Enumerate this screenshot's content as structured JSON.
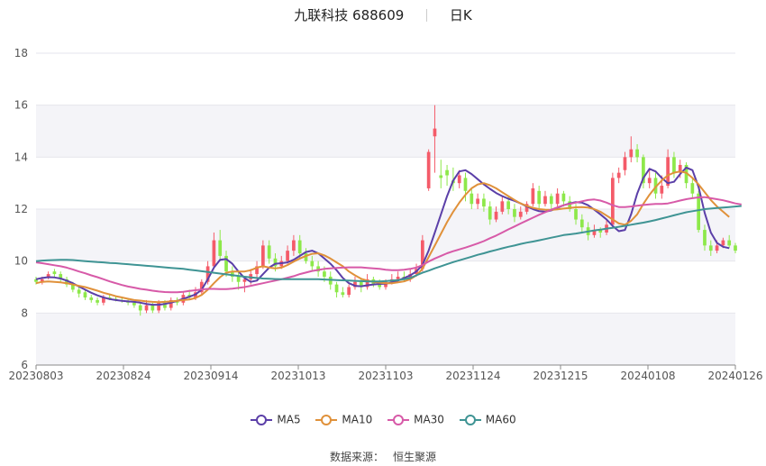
{
  "header": {
    "title": "九联科技 688609",
    "period": "日K"
  },
  "source": {
    "label": "数据来源：",
    "name": "恒生聚源"
  },
  "colors": {
    "up": "#f45b69",
    "down": "#8de84a",
    "ma5": "#5b3fa8",
    "ma10": "#e0913a",
    "ma30": "#d75aa8",
    "ma60": "#3f9494",
    "grid": "#e6e6ec",
    "plot_bg": "#f4f4f8"
  },
  "chart_data": {
    "type": "candlestick",
    "ylim": [
      6,
      18
    ],
    "yticks": [
      "6",
      "8",
      "10",
      "12",
      "14",
      "16",
      "18"
    ],
    "xticks": [
      "20230803",
      "20230824",
      "20230914",
      "20231013",
      "20231103",
      "20231124",
      "20231215",
      "20240108",
      "20240126"
    ],
    "legend_position": "bottom",
    "grid": true,
    "series": [
      {
        "name": "MA5",
        "color": "#5b3fa8",
        "values": [
          9.3,
          9.35,
          9.38,
          9.37,
          9.33,
          9.25,
          9.15,
          9.02,
          8.9,
          8.78,
          8.68,
          8.6,
          8.54,
          8.5,
          8.47,
          8.45,
          8.43,
          8.4,
          8.35,
          8.32,
          8.32,
          8.35,
          8.4,
          8.47,
          8.55,
          8.63,
          8.72,
          8.9,
          9.3,
          9.75,
          10.05,
          10.08,
          9.9,
          9.6,
          9.35,
          9.2,
          9.25,
          9.5,
          9.75,
          9.9,
          9.92,
          9.95,
          10.05,
          10.2,
          10.35,
          10.4,
          10.3,
          10.1,
          9.9,
          9.65,
          9.35,
          9.15,
          9.05,
          9.03,
          9.07,
          9.1,
          9.12,
          9.13,
          9.18,
          9.25,
          9.35,
          9.45,
          9.6,
          9.85,
          10.4,
          11.1,
          11.8,
          12.5,
          13.1,
          13.45,
          13.5,
          13.35,
          13.15,
          12.95,
          12.78,
          12.62,
          12.5,
          12.4,
          12.32,
          12.22,
          12.1,
          12.0,
          11.92,
          11.9,
          11.95,
          12.05,
          12.15,
          12.22,
          12.27,
          12.25,
          12.15,
          11.98,
          11.8,
          11.6,
          11.35,
          11.15,
          11.2,
          11.8,
          12.6,
          13.2,
          13.55,
          13.45,
          13.2,
          13.0,
          13.05,
          13.35,
          13.6,
          13.5,
          12.85,
          11.85,
          11.1,
          10.7,
          10.55,
          10.5
        ]
      },
      {
        "name": "MA10",
        "color": "#e0913a",
        "values": [
          9.15,
          9.2,
          9.22,
          9.2,
          9.18,
          9.15,
          9.1,
          9.05,
          9.0,
          8.93,
          8.86,
          8.78,
          8.72,
          8.65,
          8.6,
          8.55,
          8.5,
          8.48,
          8.45,
          8.43,
          8.42,
          8.43,
          8.45,
          8.47,
          8.5,
          8.52,
          8.58,
          8.7,
          8.9,
          9.15,
          9.38,
          9.55,
          9.6,
          9.6,
          9.6,
          9.65,
          9.75,
          9.8,
          9.75,
          9.72,
          9.75,
          9.85,
          9.98,
          10.1,
          10.2,
          10.28,
          10.3,
          10.22,
          10.1,
          9.95,
          9.8,
          9.6,
          9.45,
          9.32,
          9.25,
          9.2,
          9.17,
          9.15,
          9.15,
          9.18,
          9.22,
          9.3,
          9.45,
          9.7,
          10.15,
          10.6,
          11.05,
          11.5,
          11.9,
          12.25,
          12.55,
          12.8,
          12.95,
          13.0,
          12.92,
          12.8,
          12.65,
          12.5,
          12.35,
          12.22,
          12.12,
          12.05,
          12.0,
          11.98,
          11.97,
          11.99,
          12.02,
          12.05,
          12.07,
          12.08,
          12.06,
          12.0,
          11.9,
          11.75,
          11.6,
          11.45,
          11.4,
          11.55,
          11.8,
          12.2,
          12.55,
          12.85,
          13.1,
          13.3,
          13.4,
          13.45,
          13.4,
          13.2,
          12.95,
          12.65,
          12.35,
          12.1,
          11.9,
          11.7
        ]
      },
      {
        "name": "MA30",
        "color": "#d75aa8",
        "values": [
          9.95,
          9.92,
          9.88,
          9.84,
          9.8,
          9.75,
          9.68,
          9.6,
          9.53,
          9.45,
          9.38,
          9.3,
          9.22,
          9.15,
          9.08,
          9.02,
          8.98,
          8.93,
          8.9,
          8.86,
          8.83,
          8.81,
          8.8,
          8.8,
          8.82,
          8.85,
          8.88,
          8.91,
          8.93,
          8.93,
          8.92,
          8.92,
          8.94,
          8.97,
          9.0,
          9.05,
          9.1,
          9.15,
          9.2,
          9.25,
          9.3,
          9.36,
          9.42,
          9.5,
          9.56,
          9.62,
          9.66,
          9.7,
          9.72,
          9.74,
          9.75,
          9.76,
          9.76,
          9.76,
          9.74,
          9.72,
          9.7,
          9.67,
          9.65,
          9.65,
          9.67,
          9.7,
          9.75,
          9.85,
          9.98,
          10.1,
          10.2,
          10.3,
          10.38,
          10.45,
          10.52,
          10.6,
          10.68,
          10.77,
          10.88,
          10.98,
          11.1,
          11.22,
          11.33,
          11.45,
          11.56,
          11.67,
          11.78,
          11.88,
          11.98,
          12.07,
          12.15,
          12.2,
          12.25,
          12.3,
          12.35,
          12.37,
          12.33,
          12.25,
          12.15,
          12.08,
          12.08,
          12.1,
          12.13,
          12.16,
          12.18,
          12.2,
          12.2,
          12.22,
          12.27,
          12.33,
          12.38,
          12.42,
          12.45,
          12.46,
          12.42,
          12.38,
          12.34,
          12.28,
          12.22,
          12.18
        ]
      },
      {
        "name": "MA60",
        "color": "#3f9494",
        "values": [
          10.0,
          10.02,
          10.03,
          10.04,
          10.05,
          10.05,
          10.04,
          10.02,
          10.0,
          9.98,
          9.96,
          9.95,
          9.93,
          9.92,
          9.9,
          9.88,
          9.86,
          9.84,
          9.82,
          9.8,
          9.78,
          9.76,
          9.74,
          9.72,
          9.7,
          9.67,
          9.64,
          9.61,
          9.58,
          9.55,
          9.52,
          9.49,
          9.46,
          9.43,
          9.4,
          9.37,
          9.35,
          9.33,
          9.32,
          9.31,
          9.3,
          9.3,
          9.3,
          9.3,
          9.3,
          9.3,
          9.3,
          9.29,
          9.28,
          9.27,
          9.26,
          9.25,
          9.24,
          9.23,
          9.22,
          9.22,
          9.22,
          9.23,
          9.25,
          9.27,
          9.3,
          9.35,
          9.45,
          9.55,
          9.63,
          9.72,
          9.8,
          9.88,
          9.96,
          10.03,
          10.1,
          10.17,
          10.24,
          10.3,
          10.37,
          10.43,
          10.49,
          10.55,
          10.6,
          10.66,
          10.71,
          10.75,
          10.8,
          10.85,
          10.9,
          10.95,
          11.0,
          11.03,
          11.06,
          11.1,
          11.14,
          11.18,
          11.21,
          11.25,
          11.28,
          11.32,
          11.36,
          11.4,
          11.44,
          11.48,
          11.53,
          11.58,
          11.64,
          11.7,
          11.76,
          11.82,
          11.88,
          11.92,
          11.96,
          12.0,
          12.02,
          12.04,
          12.06,
          12.08,
          12.1,
          12.12
        ]
      }
    ],
    "candles": [
      [
        9.3,
        9.2,
        9.4,
        9.1
      ],
      [
        9.2,
        9.3,
        9.4,
        9.1
      ],
      [
        9.4,
        9.5,
        9.6,
        9.3
      ],
      [
        9.6,
        9.5,
        9.7,
        9.4
      ],
      [
        9.5,
        9.3,
        9.6,
        9.2
      ],
      [
        9.3,
        9.1,
        9.4,
        9.0
      ],
      [
        9.1,
        8.9,
        9.2,
        8.8
      ],
      [
        8.9,
        8.75,
        9.0,
        8.6
      ],
      [
        8.8,
        8.6,
        8.9,
        8.5
      ],
      [
        8.6,
        8.5,
        8.7,
        8.4
      ],
      [
        8.5,
        8.4,
        8.6,
        8.3
      ],
      [
        8.4,
        8.6,
        8.7,
        8.3
      ],
      [
        8.6,
        8.55,
        8.7,
        8.5
      ],
      [
        8.55,
        8.5,
        8.65,
        8.45
      ],
      [
        8.5,
        8.45,
        8.6,
        8.4
      ],
      [
        8.45,
        8.4,
        8.55,
        8.3
      ],
      [
        8.4,
        8.3,
        8.5,
        8.2
      ],
      [
        8.3,
        8.1,
        8.4,
        7.9
      ],
      [
        8.1,
        8.3,
        8.5,
        8.0
      ],
      [
        8.3,
        8.1,
        8.4,
        8.0
      ],
      [
        8.1,
        8.4,
        8.5,
        8.0
      ],
      [
        8.4,
        8.2,
        8.5,
        8.1
      ],
      [
        8.2,
        8.5,
        8.6,
        8.1
      ],
      [
        8.5,
        8.4,
        8.6,
        8.3
      ],
      [
        8.4,
        8.7,
        8.8,
        8.3
      ],
      [
        8.7,
        8.6,
        8.9,
        8.5
      ],
      [
        8.6,
        8.8,
        9.0,
        8.5
      ],
      [
        8.8,
        9.2,
        9.3,
        8.7
      ],
      [
        9.2,
        9.8,
        10.0,
        9.1
      ],
      [
        9.8,
        10.8,
        11.1,
        9.7
      ],
      [
        10.8,
        10.2,
        11.2,
        10.0
      ],
      [
        10.2,
        9.6,
        10.4,
        9.4
      ],
      [
        9.6,
        9.4,
        9.8,
        9.2
      ],
      [
        9.4,
        9.2,
        9.6,
        8.9
      ],
      [
        9.2,
        9.3,
        9.4,
        8.8
      ],
      [
        9.3,
        9.5,
        9.7,
        9.1
      ],
      [
        9.5,
        9.8,
        10.0,
        9.3
      ],
      [
        9.8,
        10.6,
        10.8,
        9.7
      ],
      [
        10.6,
        10.1,
        10.8,
        9.9
      ],
      [
        10.1,
        9.8,
        10.3,
        9.6
      ],
      [
        9.8,
        10.0,
        10.2,
        9.7
      ],
      [
        10.0,
        10.4,
        10.6,
        9.9
      ],
      [
        10.4,
        10.8,
        11.0,
        10.2
      ],
      [
        10.8,
        10.3,
        11.0,
        10.1
      ],
      [
        10.3,
        10.0,
        10.5,
        9.9
      ],
      [
        10.0,
        9.8,
        10.2,
        9.6
      ],
      [
        9.8,
        9.6,
        10.0,
        9.4
      ],
      [
        9.6,
        9.4,
        9.8,
        9.2
      ],
      [
        9.4,
        9.1,
        9.6,
        8.9
      ],
      [
        9.1,
        8.8,
        9.2,
        8.6
      ],
      [
        8.8,
        8.7,
        9.0,
        8.6
      ],
      [
        8.7,
        9.0,
        9.1,
        8.6
      ],
      [
        9.0,
        9.2,
        9.4,
        8.9
      ],
      [
        9.2,
        9.0,
        9.3,
        8.8
      ],
      [
        9.0,
        9.3,
        9.5,
        8.9
      ],
      [
        9.3,
        9.1,
        9.4,
        9.0
      ],
      [
        9.1,
        9.0,
        9.3,
        8.9
      ],
      [
        9.0,
        9.2,
        9.3,
        8.9
      ],
      [
        9.2,
        9.3,
        9.5,
        9.1
      ],
      [
        9.3,
        9.4,
        9.6,
        9.2
      ],
      [
        9.4,
        9.3,
        9.6,
        9.2
      ],
      [
        9.3,
        9.5,
        9.7,
        9.2
      ],
      [
        9.5,
        9.7,
        9.9,
        9.4
      ],
      [
        9.7,
        10.8,
        11.0,
        9.6
      ],
      [
        12.8,
        14.2,
        14.3,
        12.7
      ],
      [
        14.8,
        15.1,
        16.0,
        13.4
      ],
      [
        13.3,
        13.2,
        13.9,
        12.8
      ],
      [
        13.5,
        13.3,
        13.7,
        12.9
      ],
      [
        13.1,
        13.0,
        13.6,
        12.7
      ],
      [
        13.0,
        13.3,
        13.5,
        12.8
      ],
      [
        13.2,
        12.7,
        13.4,
        12.3
      ],
      [
        12.6,
        12.2,
        12.8,
        12.0
      ],
      [
        12.2,
        12.4,
        12.6,
        12.0
      ],
      [
        12.4,
        12.1,
        12.6,
        11.9
      ],
      [
        12.1,
        11.6,
        12.3,
        11.4
      ],
      [
        11.6,
        11.9,
        12.1,
        11.5
      ],
      [
        11.9,
        12.3,
        12.5,
        11.8
      ],
      [
        12.3,
        12.0,
        12.5,
        11.8
      ],
      [
        12.0,
        11.7,
        12.2,
        11.5
      ],
      [
        11.7,
        11.9,
        12.1,
        11.6
      ],
      [
        11.9,
        12.2,
        12.3,
        11.8
      ],
      [
        12.2,
        12.8,
        13.0,
        12.1
      ],
      [
        12.7,
        12.2,
        12.9,
        12.0
      ],
      [
        12.2,
        12.5,
        12.7,
        12.1
      ],
      [
        12.5,
        12.2,
        12.6,
        12.0
      ],
      [
        12.2,
        12.6,
        12.8,
        12.1
      ],
      [
        12.6,
        12.3,
        12.7,
        12.1
      ],
      [
        12.3,
        12.0,
        12.5,
        11.9
      ],
      [
        12.0,
        11.6,
        12.2,
        11.4
      ],
      [
        11.6,
        11.3,
        11.8,
        11.1
      ],
      [
        11.3,
        11.0,
        11.5,
        10.8
      ],
      [
        11.0,
        11.2,
        11.4,
        10.9
      ],
      [
        11.2,
        11.1,
        11.3,
        10.9
      ],
      [
        11.1,
        11.4,
        11.6,
        11.0
      ],
      [
        11.4,
        13.2,
        13.4,
        11.3
      ],
      [
        13.2,
        13.4,
        13.6,
        13.0
      ],
      [
        13.5,
        14.0,
        14.2,
        13.3
      ],
      [
        14.0,
        14.3,
        14.8,
        13.8
      ],
      [
        14.3,
        14.0,
        14.5,
        13.8
      ],
      [
        14.0,
        13.0,
        14.1,
        12.8
      ],
      [
        13.0,
        13.2,
        13.5,
        12.8
      ],
      [
        13.2,
        12.6,
        13.4,
        12.4
      ],
      [
        12.6,
        12.9,
        13.3,
        12.4
      ],
      [
        12.9,
        14.0,
        14.3,
        12.8
      ],
      [
        14.0,
        13.4,
        14.2,
        13.2
      ],
      [
        13.4,
        13.7,
        13.9,
        13.2
      ],
      [
        13.7,
        13.0,
        13.8,
        12.8
      ],
      [
        13.0,
        12.6,
        13.2,
        12.4
      ],
      [
        12.6,
        11.2,
        12.7,
        11.1
      ],
      [
        11.2,
        10.6,
        11.4,
        10.4
      ],
      [
        10.6,
        10.4,
        10.8,
        10.2
      ],
      [
        10.4,
        10.6,
        10.8,
        10.3
      ],
      [
        10.6,
        10.8,
        10.9,
        10.5
      ],
      [
        10.8,
        10.6,
        11.0,
        10.5
      ],
      [
        10.6,
        10.4,
        10.7,
        10.3
      ]
    ]
  },
  "legend": {
    "items": [
      {
        "key": "ma5",
        "label": "MA5"
      },
      {
        "key": "ma10",
        "label": "MA10"
      },
      {
        "key": "ma30",
        "label": "MA30"
      },
      {
        "key": "ma60",
        "label": "MA60"
      }
    ]
  }
}
